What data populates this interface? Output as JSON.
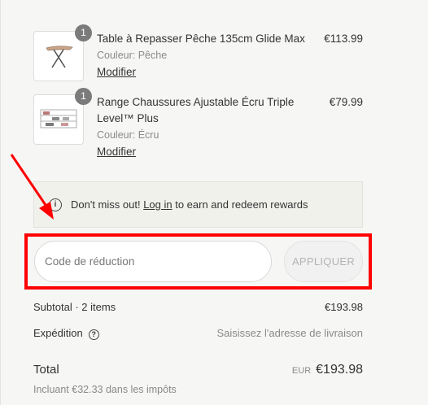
{
  "cart": {
    "items": [
      {
        "quantity": "1",
        "name": "Table à Repasser Pêche 135cm Glide Max",
        "variant": "Couleur: Pêche",
        "modify_label": "Modifier",
        "price": "€113.99"
      },
      {
        "quantity": "1",
        "name": "Range Chaussures Ajustable Écru Triple Level™ Plus",
        "variant": "Couleur: Écru",
        "modify_label": "Modifier",
        "price": "€79.99"
      }
    ]
  },
  "rewards": {
    "text_before": "Don't miss out! ",
    "login_label": "Log in",
    "text_after": " to earn and redeem rewards"
  },
  "discount": {
    "placeholder": "Code de réduction",
    "apply_label": "APPLIQUER"
  },
  "summary": {
    "subtotal_label": "Subtotal · 2 items",
    "subtotal_value": "€193.98",
    "shipping_label": "Expédition",
    "shipping_value": "Saisissez l'adresse de livraison",
    "total_label": "Total",
    "currency": "EUR",
    "total_value": "€193.98",
    "tax_note": "Incluant €32.33 dans les impôts"
  },
  "annotation": {
    "arrow_color": "#ff0000",
    "box_color": "#ff0000"
  }
}
